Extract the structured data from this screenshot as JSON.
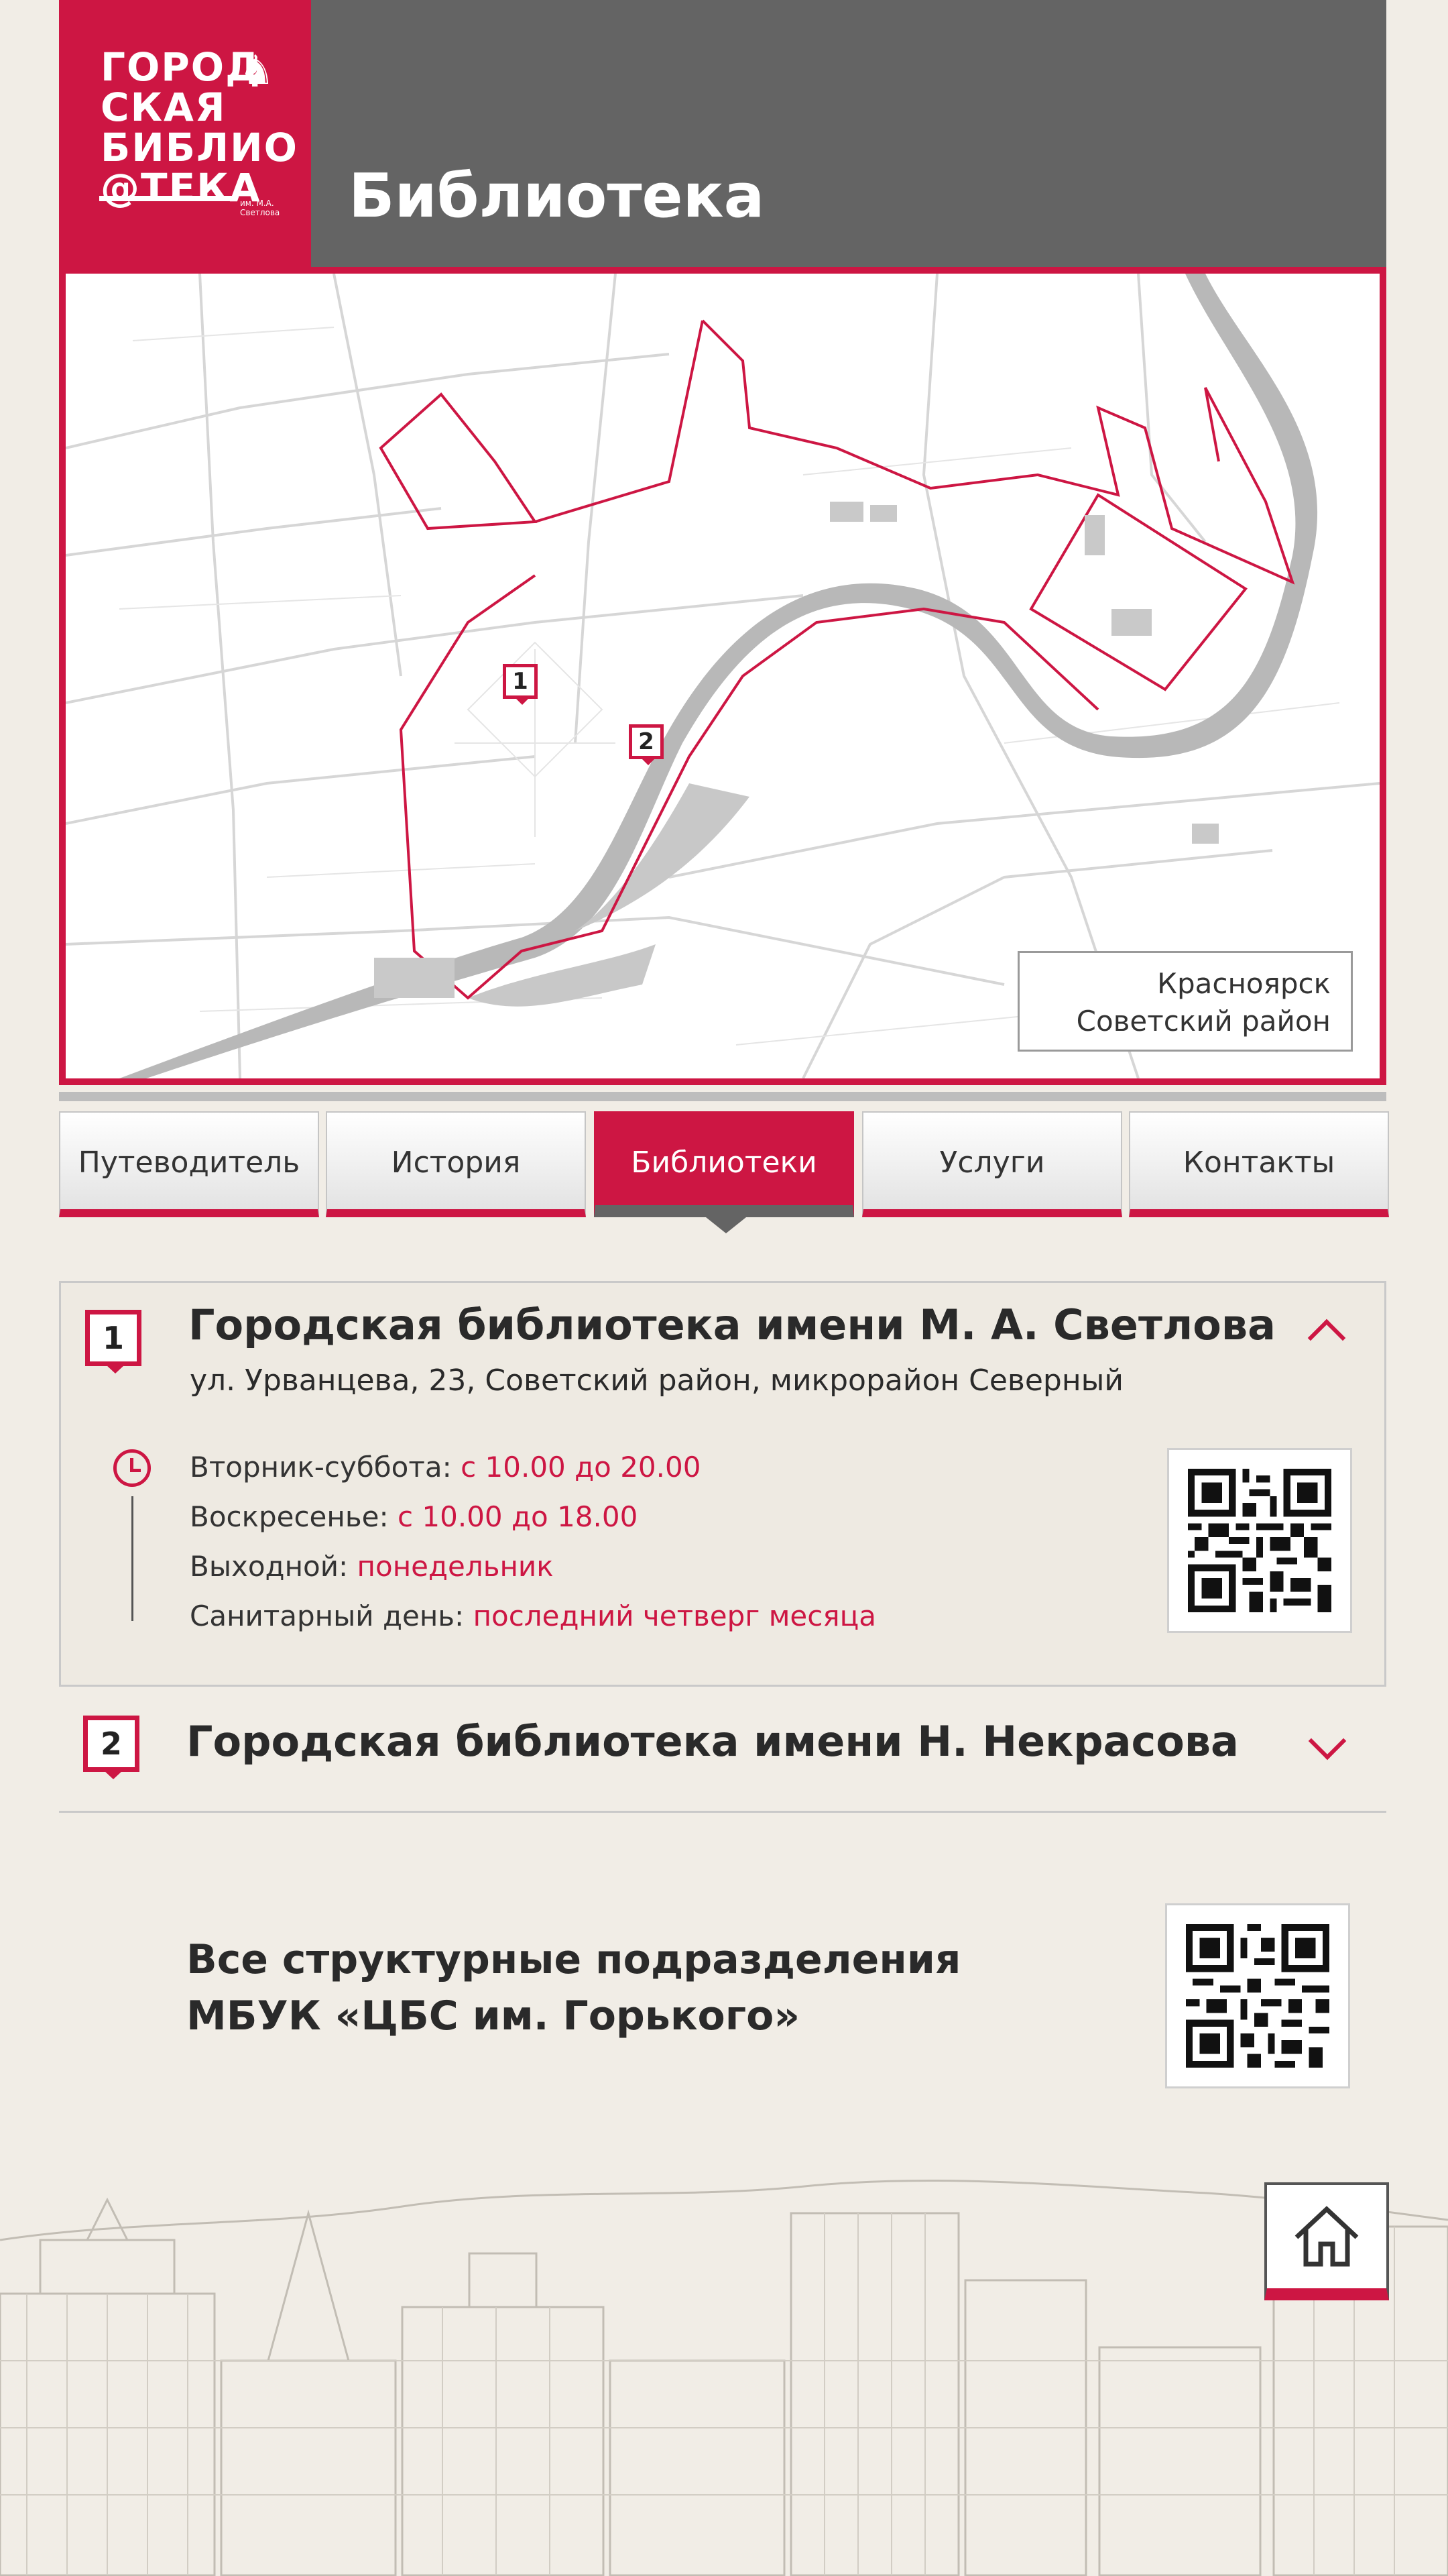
{
  "header": {
    "logo_text": [
      "ГОРОД",
      "СКАЯ",
      "БИБЛИО",
      "@ТЕКА"
    ],
    "logo_sub": "им. М.А. Светлова",
    "title": "Библиотека"
  },
  "map": {
    "city": "Красноярск",
    "district": "Советский район",
    "pins": [
      {
        "label": "1"
      },
      {
        "label": "2"
      }
    ]
  },
  "tabs": [
    {
      "label": "Путеводитель",
      "active": false
    },
    {
      "label": "История",
      "active": false
    },
    {
      "label": "Библиотеки",
      "active": true
    },
    {
      "label": "Услуги",
      "active": false
    },
    {
      "label": "Контакты",
      "active": false
    }
  ],
  "libraries": [
    {
      "number": "1",
      "name": "Городская библиотека имени М. А. Светлова",
      "address": "ул. Урванцева, 23, Советский район, микрорайон Северный",
      "schedule": [
        {
          "label": "Вторник-суббота:",
          "value": "с 10.00 до 20.00"
        },
        {
          "label": "Воскресенье:",
          "value": "с 10.00 до 18.00"
        },
        {
          "label": "Выходной:",
          "value": "понедельник"
        },
        {
          "label": "Санитарный день:",
          "value": "последний четверг месяца"
        }
      ],
      "expanded": true
    },
    {
      "number": "2",
      "name": "Городская библиотека имени Н. Некрасова",
      "expanded": false
    }
  ],
  "all_units": {
    "line1": "Все структурные подразделения",
    "line2": "МБУК «ЦБС им. Горького»"
  },
  "colors": {
    "accent": "#cd1643",
    "header_gray": "#646464",
    "background": "#f1ede6"
  },
  "icons": {
    "home": "home-icon",
    "clock": "clock-icon",
    "qr": "qr-code-icon"
  }
}
